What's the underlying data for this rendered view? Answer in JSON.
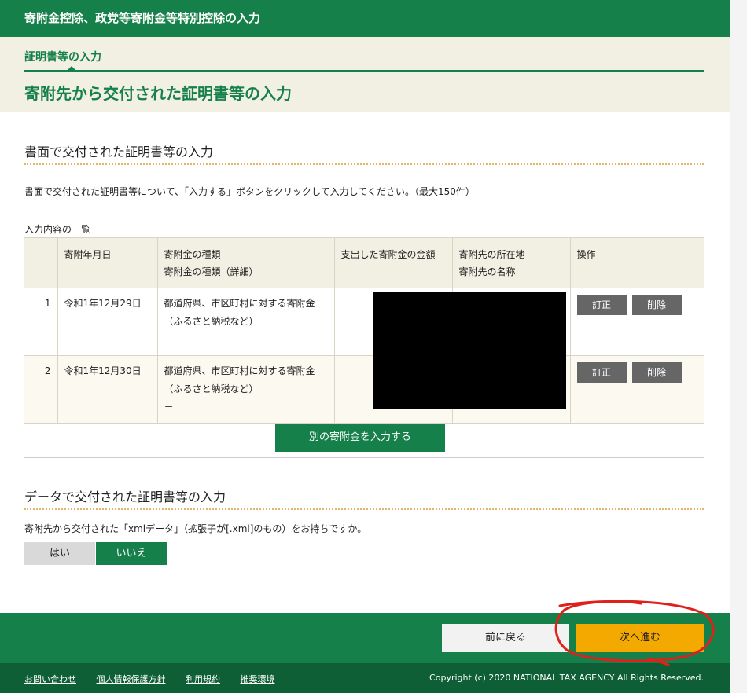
{
  "app": {
    "title": "寄附金控除、政党等寄附金等特別控除の入力"
  },
  "header": {
    "step": "証明書等の入力",
    "title": "寄附先から交付された証明書等の入力"
  },
  "paper": {
    "title": "書面で交付された証明書等の入力",
    "desc": "書面で交付された証明書等について、「入力する」ボタンをクリックして入力してください。（最大150件）",
    "list_caption": "入力内容の一覧",
    "columns": {
      "date": "寄附年月日",
      "type1": "寄附金の種類",
      "type2": "寄附金の種類（詳細）",
      "amount": "支出した寄附金の金額",
      "loc1": "寄附先の所在地",
      "loc2": "寄附先の名称",
      "op": "操作"
    },
    "rows": [
      {
        "num": "1",
        "date": "令和1年12月29日",
        "type1": "都道府県、市区町村に対する寄附金",
        "type2": "（ふるさと納税など）",
        "detail": "－",
        "edit": "訂正",
        "delete": "削除"
      },
      {
        "num": "2",
        "date": "令和1年12月30日",
        "type1": "都道府県、市区町村に対する寄附金",
        "type2": "（ふるさと納税など）",
        "detail": "－",
        "edit": "訂正",
        "delete": "削除"
      }
    ],
    "add_button": "別の寄附金を入力する"
  },
  "data": {
    "title": "データで交付された証明書等の入力",
    "question": "寄附先から交付された「xmlデータ」（拡張子が[.xml]のもの）をお持ちですか。",
    "yes": "はい",
    "no": "いいえ"
  },
  "footer": {
    "back": "前に戻る",
    "next": "次へ進む"
  },
  "bottom": {
    "links": [
      "お問い合わせ",
      "個人情報保護方針",
      "利用規約",
      "推奨環境"
    ],
    "copyright": "Copyright (c) 2020 NATIONAL TAX AGENCY All Rights Reserved."
  },
  "colors": {
    "brand": "#16804a",
    "accent": "#f4a900",
    "annotation": "#e0201a"
  }
}
